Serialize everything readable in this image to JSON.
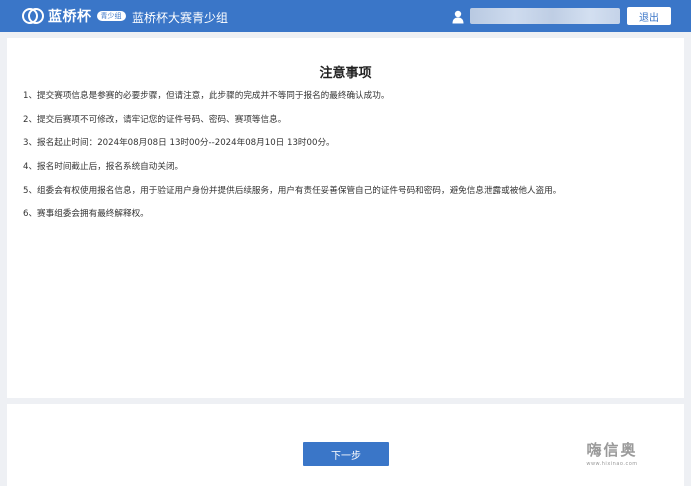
{
  "header": {
    "logo_text": "蓝桥杯",
    "logo_badge": "青少组",
    "title": "蓝桥杯大赛青少组",
    "logout_label": "退出"
  },
  "notice": {
    "title": "注意事项",
    "items": [
      "1、提交赛项信息是参赛的必要步骤，但请注意，此步骤的完成并不等同于报名的最终确认成功。",
      "2、提交后赛项不可修改，请牢记您的证件号码、密码、赛项等信息。",
      "3、报名起止时间：2024年08月08日 13时00分--2024年08月10日 13时00分。",
      "4、报名时间截止后，报名系统自动关闭。",
      "5、组委会有权使用报名信息，用于验证用户身份并提供后续服务，用户有责任妥善保管自己的证件号码和密码，避免信息泄露或被他人盗用。",
      "6、赛事组委会拥有最终解释权。"
    ]
  },
  "footer": {
    "next_label": "下一步"
  },
  "watermark": {
    "main": "嗨信奥",
    "sub": "www.hixinao.com"
  },
  "colors": {
    "primary": "#3a76c8",
    "background": "#eef0f4",
    "card": "#ffffff"
  },
  "icons": {
    "logo": "lanqiao-logo-icon",
    "user": "user-icon"
  }
}
